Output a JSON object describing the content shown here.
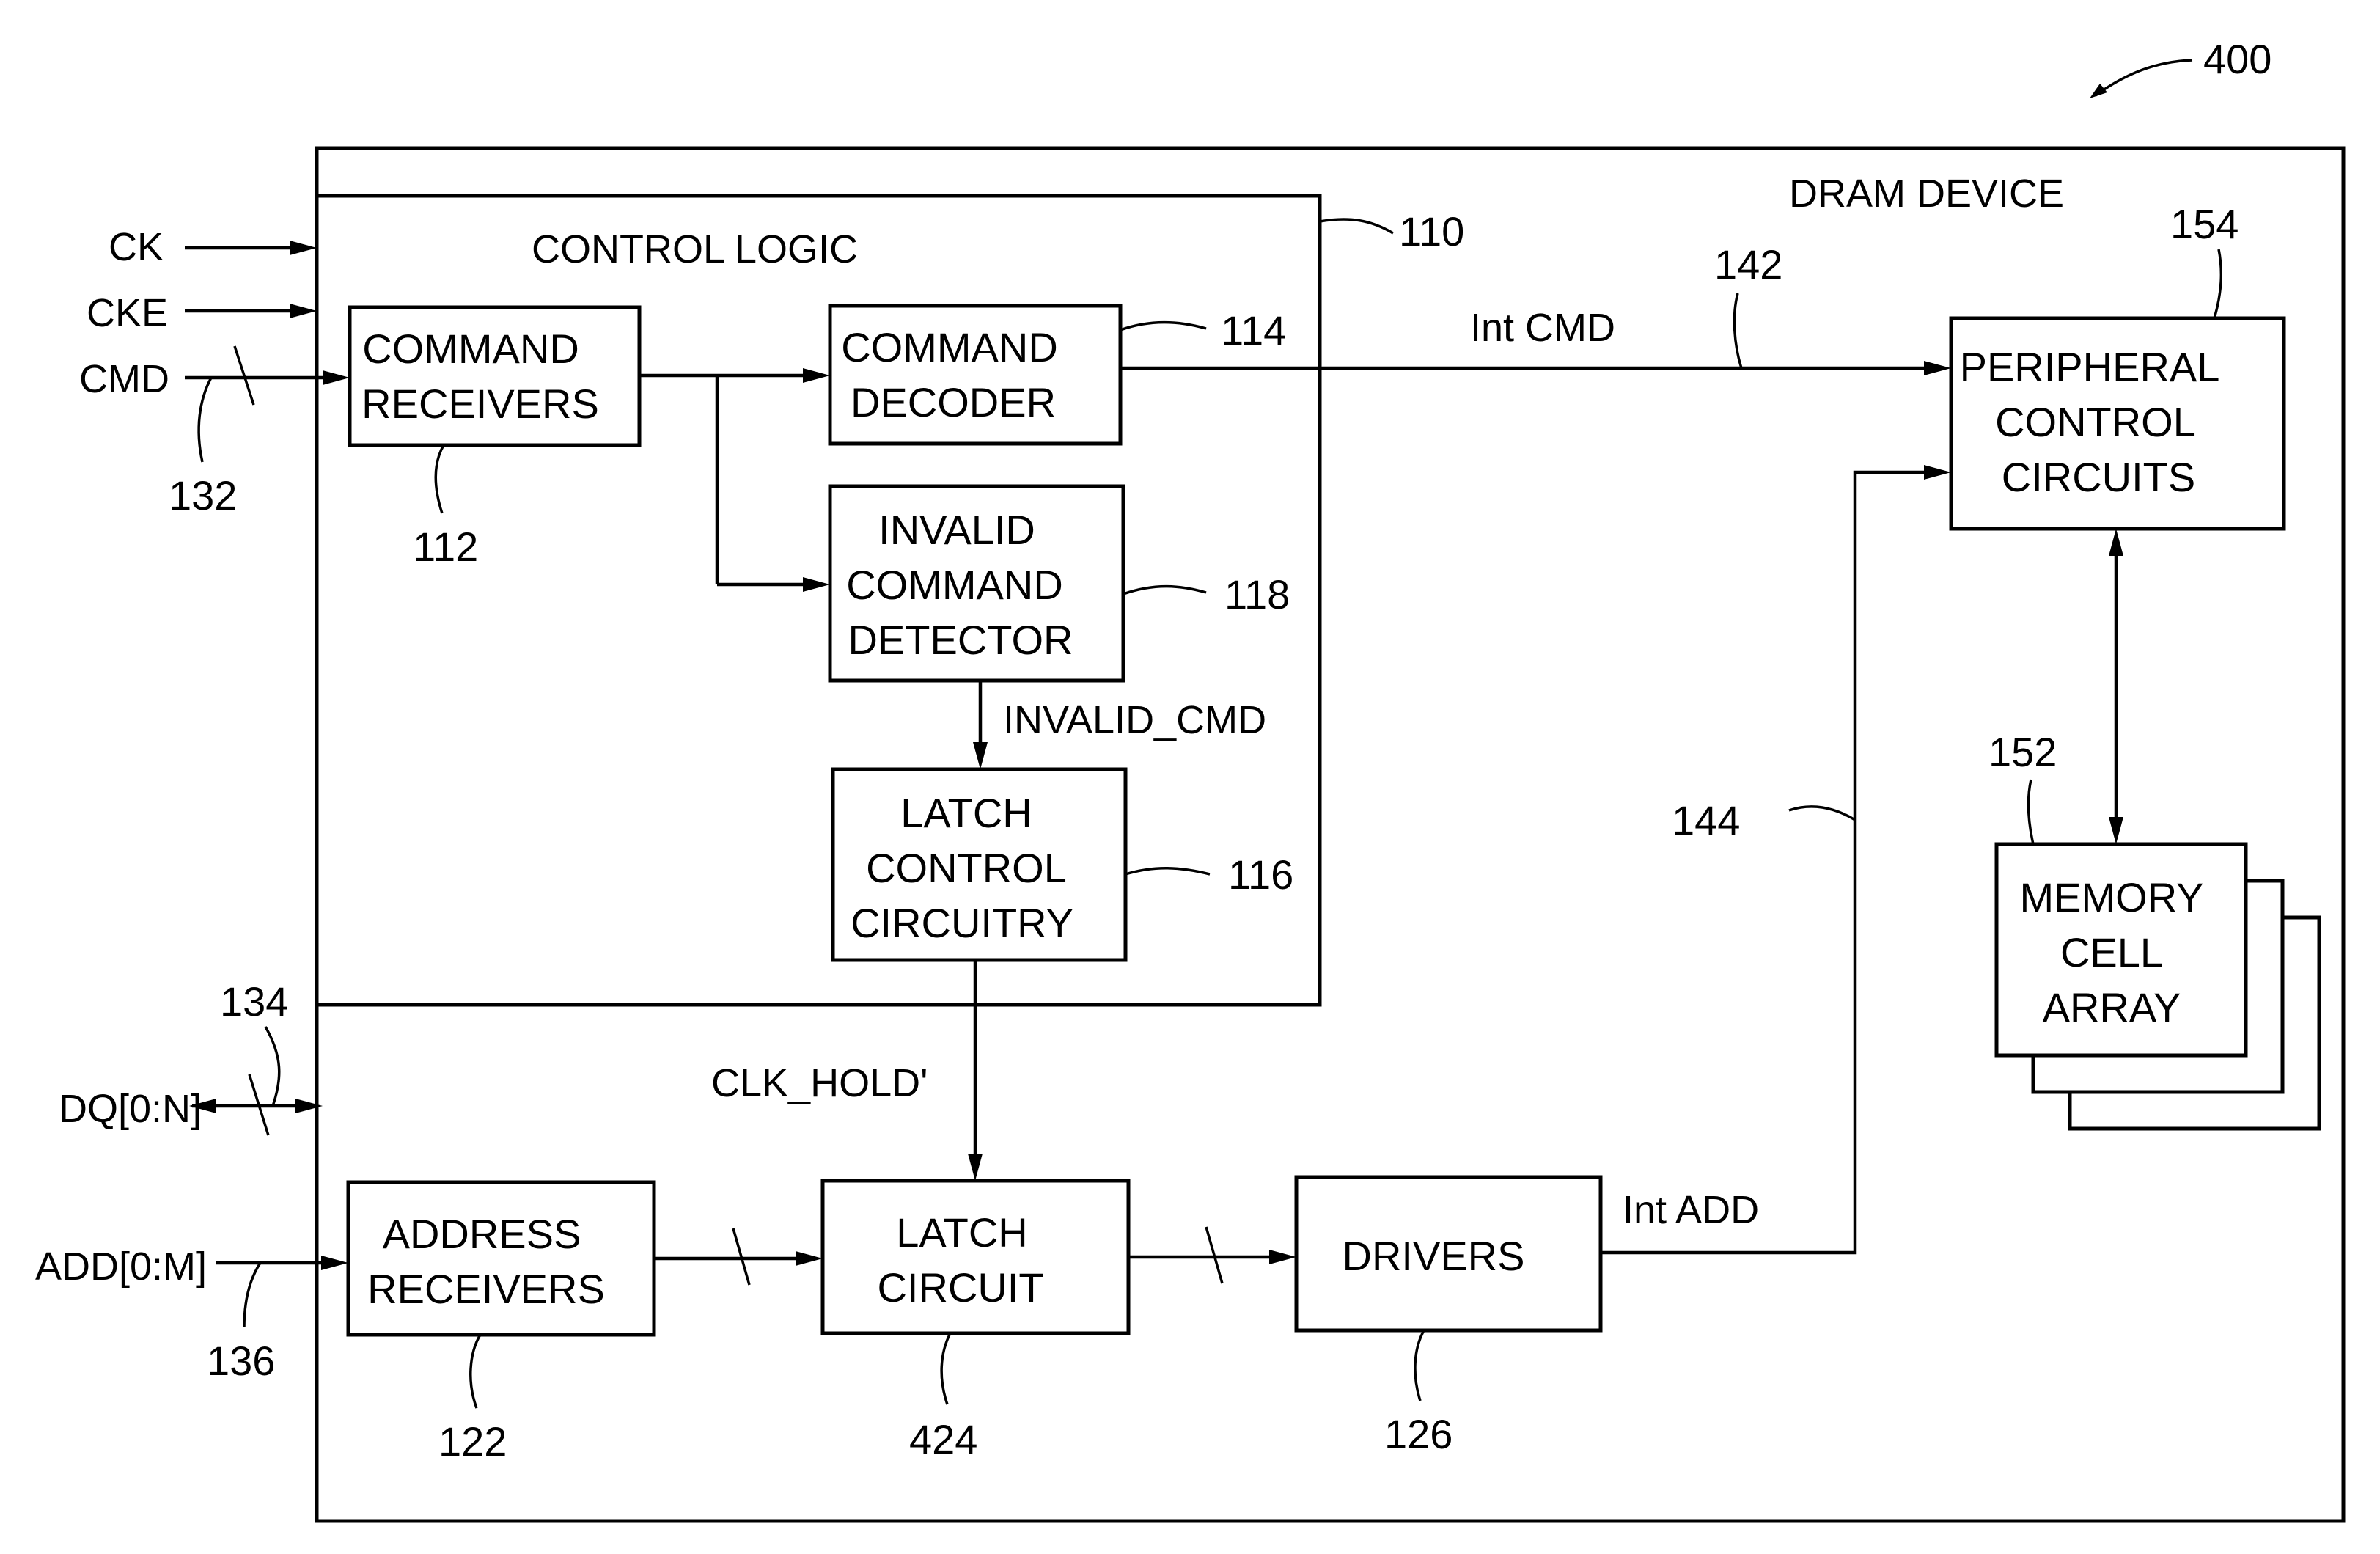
{
  "figure": {
    "ref": "400",
    "device_title": "DRAM DEVICE",
    "device_ref": "400"
  },
  "control_logic": {
    "title": "CONTROL LOGIC",
    "ref": "110"
  },
  "inputs": {
    "ck": "CK",
    "cke": "CKE",
    "cmd": "CMD",
    "cmd_ref": "132",
    "dq": "DQ[0:N]",
    "dq_ref": "134",
    "add": "ADD[0:M]",
    "add_ref": "136"
  },
  "blocks": {
    "command_receivers": {
      "lines": [
        "COMMAND",
        "RECEIVERS"
      ],
      "ref": "112"
    },
    "command_decoder": {
      "lines": [
        "COMMAND",
        "DECODER"
      ],
      "ref": "114"
    },
    "invalid_command_detector": {
      "lines": [
        "INVALID",
        "COMMAND",
        "DETECTOR"
      ],
      "ref": "118"
    },
    "latch_control_circuitry": {
      "lines": [
        "LATCH",
        "CONTROL",
        "CIRCUITRY"
      ],
      "ref": "116"
    },
    "peripheral_control_circuits": {
      "lines": [
        "PERIPHERAL",
        "CONTROL",
        "CIRCUITS"
      ],
      "ref": "154"
    },
    "memory_cell_array": {
      "lines": [
        "MEMORY",
        "CELL",
        "ARRAY"
      ],
      "ref": "152"
    },
    "address_receivers": {
      "lines": [
        "ADDRESS",
        "RECEIVERS"
      ],
      "ref": "122"
    },
    "latch_circuit": {
      "lines": [
        "LATCH",
        "CIRCUIT"
      ],
      "ref": "424"
    },
    "drivers": {
      "lines": [
        "DRIVERS"
      ],
      "ref": "126"
    }
  },
  "signals": {
    "int_cmd": "Int CMD",
    "int_cmd_ref": "142",
    "invalid_cmd": "INVALID_CMD",
    "clk_hold": "CLK_HOLD'",
    "int_add": "Int ADD",
    "int_add_ref": "144"
  }
}
